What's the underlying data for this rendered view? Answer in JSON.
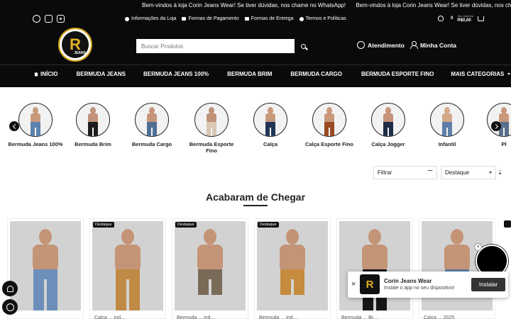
{
  "announcement": {
    "messages": [
      "Bem-vindos à loja Corin Jeans Wear! Se tiver dúvidas, nos chame no WhatsApp!",
      "Bem-vindos à loja Corin Jeans Wear! Se tiver dúvidas, nos cham"
    ]
  },
  "social": [
    "whatsapp-icon",
    "facebook-icon",
    "instagram-icon"
  ],
  "info_links": [
    "Informações da Loja",
    "Formas de Pagamento",
    "Formas de Entrega",
    "Termos e Políticas"
  ],
  "cart": {
    "count": "0",
    "label": "Seu carrinho",
    "total": "R$0,00"
  },
  "logo": {
    "letter": "R",
    "sub": "JEANS"
  },
  "search": {
    "placeholder": "Buscar Produtos"
  },
  "header_actions": {
    "atendimento": "Atendimento",
    "minha_conta": "Minha Conta"
  },
  "nav": {
    "items": [
      "INÍCIO",
      "BERMUDA JEANS",
      "BERMUDA JEANS 100%",
      "BERMUDA BRIM",
      "BERMUDA CARGO",
      "BERMUDA ESPORTE FINO",
      "MAIS CATEGORIAS"
    ]
  },
  "categories": [
    {
      "label": "Bermuda Jeans 100%",
      "pants": "#5b82b0",
      "skin": "#c99a7a"
    },
    {
      "label": "Bermuda Brim",
      "pants": "#1c1c1c",
      "skin": "#c2927a"
    },
    {
      "label": "Bermuda Cargo",
      "pants": "#4f6f95",
      "skin": "#c4957b"
    },
    {
      "label": "Bermuda Esporte Fino",
      "pants": "#d9c7b2",
      "skin": "#c09079"
    },
    {
      "label": "Calça",
      "pants": "#1f3553",
      "skin": "#c8987c"
    },
    {
      "label": "Calça Esporte Fino",
      "pants": "#9a4a23",
      "skin": "#c9987a"
    },
    {
      "label": "Calça Jogger",
      "pants": "#1d2c47",
      "skin": "#c4937a"
    },
    {
      "label": "Infantil",
      "pants": "#5c7ea8",
      "skin": "#d3a98b"
    },
    {
      "label": "Pl",
      "pants": "#5a6f8c",
      "skin": "#c8987c"
    }
  ],
  "filters": {
    "filtrar": "Filtrar",
    "ordenar": "Destaque"
  },
  "section": {
    "title": "Acabaram de Chegar"
  },
  "products": [
    {
      "badge": "",
      "pants": "#6b8fb8",
      "name": ""
    },
    {
      "badge": "Destaque",
      "pants": "#c08a45",
      "name": "Calça ... ind..."
    },
    {
      "badge": "Destaque",
      "pants": "#7a6a58",
      "name": "Bermuda ... ind..."
    },
    {
      "badge": "Destaque",
      "pants": "#c58b3e",
      "name": "Bermuda ... ind..."
    },
    {
      "badge": "",
      "pants": "#161616",
      "name": "Bermuda ... Br..."
    },
    {
      "badge": "",
      "pants": "#5c7fa8",
      "name": "Calça ... 2025"
    }
  ],
  "install_popup": {
    "title": "Corin Jeans Wear",
    "subtitle": "Instale o app no seu dispositivo!",
    "button": "Instalar",
    "close": "×"
  },
  "colors": {
    "accent_gold": "#e0b127",
    "header_bg": "#0a0a0a"
  }
}
